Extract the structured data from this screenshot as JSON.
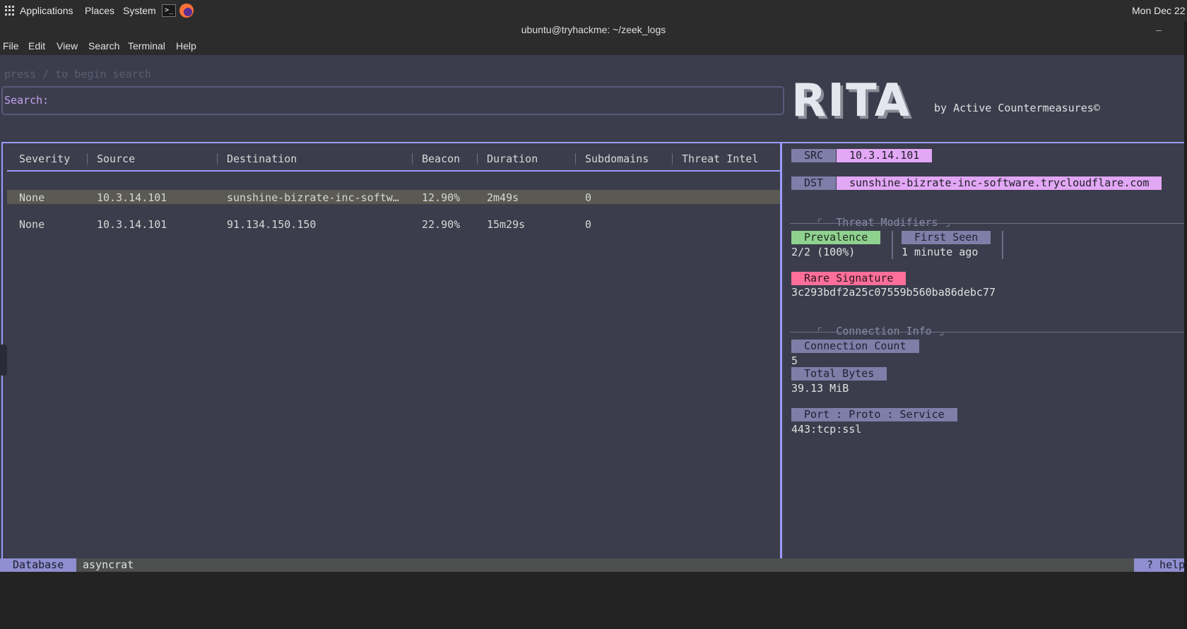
{
  "top_panel": {
    "applications": "Applications",
    "places": "Places",
    "system": "System",
    "terminal_icon_glyph": ">_",
    "clock": "Mon Dec 22"
  },
  "window": {
    "title": "ubuntu@tryhackme: ~/zeek_logs",
    "minimize": "–"
  },
  "menu": [
    "File",
    "Edit",
    "View",
    "Search",
    "Terminal",
    "Help"
  ],
  "search": {
    "hint": "press / to begin search",
    "label": "Search:"
  },
  "logo": {
    "text": "RITA",
    "byline": "by Active Countermeasures©"
  },
  "table": {
    "columns": [
      "Severity",
      "Source",
      "Destination",
      "Beacon",
      "Duration",
      "Subdomains",
      "Threat Intel"
    ],
    "rows": [
      {
        "severity": "None",
        "source": "10.3.14.101",
        "destination": "sunshine-bizrate-inc-softw…",
        "beacon": "12.90%",
        "duration": "2m49s",
        "subdomains": "0",
        "threat_intel": ""
      },
      {
        "severity": "None",
        "source": "10.3.14.101",
        "destination": "91.134.150.150",
        "beacon": "22.90%",
        "duration": "15m29s",
        "subdomains": "0",
        "threat_intel": ""
      }
    ]
  },
  "detail": {
    "src_label": "SRC",
    "src_value": "10.3.14.101",
    "dst_label": "DST",
    "dst_value": "sunshine-bizrate-inc-software.trycloudflare.com",
    "threat_modifiers_title": "Threat Modifiers",
    "prevalence_label": "Prevalence",
    "prevalence_value": "2/2 (100%)",
    "first_seen_label": "First Seen",
    "first_seen_value": "1 minute ago",
    "rare_signature_label": "Rare Signature",
    "rare_signature_value": "3c293bdf2a25c07559b560ba86debc77",
    "connection_info_title": "Connection Info",
    "connection_count_label": "Connection Count",
    "connection_count_value": "5",
    "total_bytes_label": "Total Bytes",
    "total_bytes_value": "39.13 MiB",
    "port_label": "Port : Proto : Service",
    "port_value": "443:tcp:ssl"
  },
  "status": {
    "database_label": "Database",
    "database_name": "asyncrat",
    "help": "? help"
  },
  "colors": {
    "accent_border": "#9b9bff",
    "value_tag": "#e2a7f5",
    "prevalence_tag": "#8fd18f",
    "rare_tag": "#ff6f9a"
  }
}
